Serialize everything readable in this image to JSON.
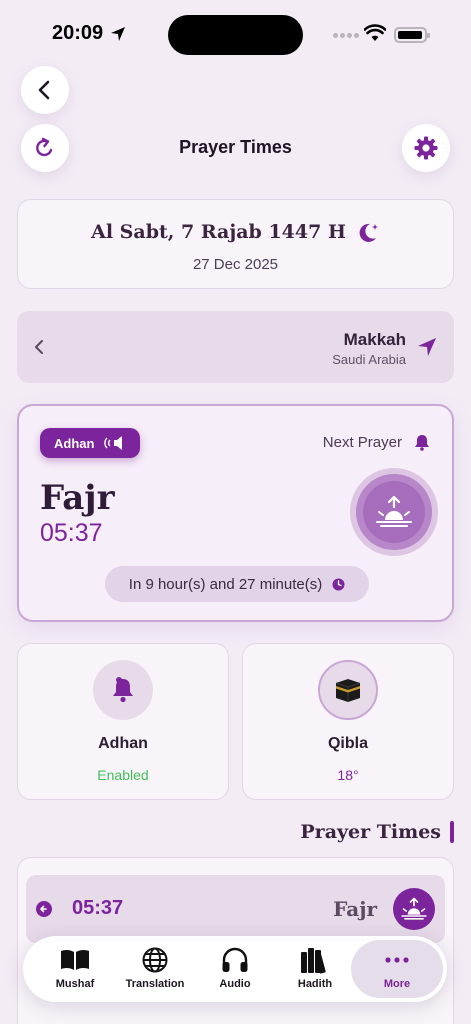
{
  "status_bar": {
    "time": "20:09"
  },
  "header": {
    "title": "Prayer Times"
  },
  "date": {
    "hijri": "Al Sabt, 7 Rajab 1447 H",
    "gregorian": "27 Dec 2025"
  },
  "location": {
    "city": "Makkah",
    "country": "Saudi Arabia"
  },
  "next_prayer": {
    "adhan_badge": "Adhan",
    "label": "Next Prayer",
    "name": "Fajr",
    "time": "05:37",
    "countdown": "In 9 hour(s) and 27 minute(s)"
  },
  "tiles": {
    "adhan": {
      "title": "Adhan",
      "status": "Enabled",
      "status_color": "#3fbf5a"
    },
    "qibla": {
      "title": "Qibla",
      "value": "18°",
      "value_color": "#7b249b"
    }
  },
  "section": {
    "title": "Prayer Times"
  },
  "prayer_list": [
    {
      "time": "05:37",
      "name": "Fajr"
    }
  ],
  "tabbar": {
    "tabs": [
      {
        "label": "Mushaf",
        "icon": "book-icon"
      },
      {
        "label": "Translation",
        "icon": "globe-icon"
      },
      {
        "label": "Audio",
        "icon": "headphones-icon"
      },
      {
        "label": "Hadith",
        "icon": "books-icon"
      },
      {
        "label": "More",
        "icon": "more-icon",
        "active": true
      }
    ]
  },
  "colors": {
    "accent": "#7b249b",
    "background": "#f3ecf5",
    "success": "#3fbf5a"
  }
}
